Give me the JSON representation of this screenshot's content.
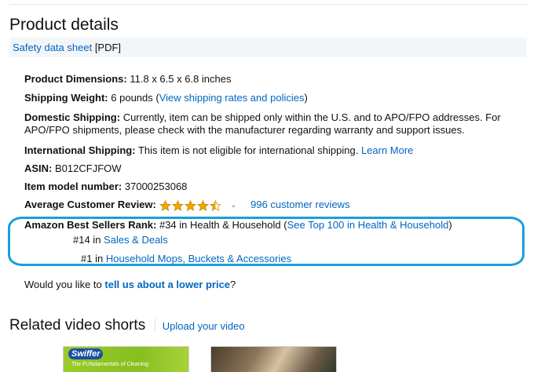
{
  "product_details": {
    "heading": "Product details",
    "safety_link": "Safety data sheet",
    "safety_format": "[PDF]",
    "rows": {
      "dimensions": {
        "label": "Product Dimensions:",
        "value": "11.8 x 6.5 x 6.8 inches"
      },
      "weight": {
        "label": "Shipping Weight:",
        "value": "6 pounds (",
        "link": "View shipping rates and policies",
        "suffix": ")"
      },
      "domestic": {
        "label": "Domestic Shipping:",
        "value": "Currently, item can be shipped only within the U.S. and to APO/FPO addresses. For APO/FPO shipments, please check with the manufacturer regarding warranty and support issues."
      },
      "international": {
        "label": "International Shipping:",
        "value": "This item is not eligible for international shipping.",
        "link": "Learn More"
      },
      "asin": {
        "label": "ASIN:",
        "value": "B012CFJFOW"
      },
      "model": {
        "label": "Item model number:",
        "value": "37000253068"
      },
      "review": {
        "label": "Average Customer Review:",
        "rating": 4.5,
        "reviews_link": "996 customer reviews"
      },
      "rank": {
        "label": "Amazon Best Sellers Rank:",
        "main": "#34 in Health & Household (",
        "main_link": "See Top 100 in Health & Household",
        "main_suffix": ")",
        "sub1_rank": "#14 in",
        "sub1_link": "Sales & Deals",
        "sub2_rank": "#1 in",
        "sub2_link": "Household Mops, Buckets & Accessories"
      }
    },
    "lower_price_prefix": "Would you like to",
    "lower_price_link": "tell us about a lower price",
    "lower_price_suffix": "?"
  },
  "related_videos": {
    "heading": "Related video shorts",
    "upload_link": "Upload your video",
    "video1_logo": "Swiffer",
    "video1_caption": "The FUNdamentals of Cleaning"
  },
  "colors": {
    "link": "#0066c0",
    "star": "#f0a600",
    "highlight": "#1a9ed9",
    "bar": "#f3f6f9"
  }
}
